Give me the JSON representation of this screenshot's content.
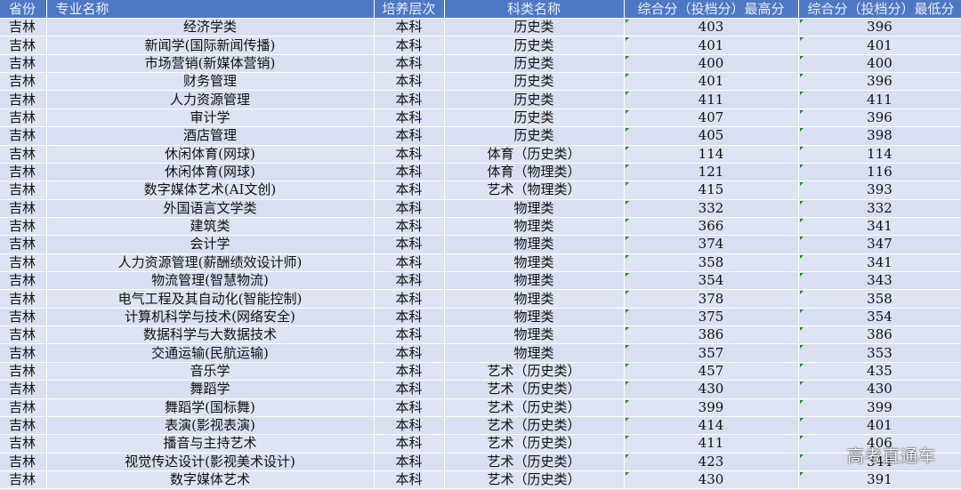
{
  "headers": [
    "省份",
    "专业名称",
    "培养层次",
    "科类名称",
    "综合分（投档分）最高分",
    "综合分（投档分）最低分"
  ],
  "rows": [
    [
      "吉林",
      "经济学类",
      "本科",
      "历史类",
      "403",
      "396"
    ],
    [
      "吉林",
      "新闻学(国际新闻传播)",
      "本科",
      "历史类",
      "401",
      "401"
    ],
    [
      "吉林",
      "市场营销(新媒体营销)",
      "本科",
      "历史类",
      "400",
      "400"
    ],
    [
      "吉林",
      "财务管理",
      "本科",
      "历史类",
      "401",
      "396"
    ],
    [
      "吉林",
      "人力资源管理",
      "本科",
      "历史类",
      "411",
      "411"
    ],
    [
      "吉林",
      "审计学",
      "本科",
      "历史类",
      "407",
      "396"
    ],
    [
      "吉林",
      "酒店管理",
      "本科",
      "历史类",
      "405",
      "398"
    ],
    [
      "吉林",
      "休闲体育(网球)",
      "本科",
      "体育（历史类）",
      "114",
      "114"
    ],
    [
      "吉林",
      "休闲体育(网球)",
      "本科",
      "体育（物理类）",
      "121",
      "116"
    ],
    [
      "吉林",
      "数字媒体艺术(AI文创)",
      "本科",
      "艺术（物理类）",
      "415",
      "393"
    ],
    [
      "吉林",
      "外国语言文学类",
      "本科",
      "物理类",
      "332",
      "332"
    ],
    [
      "吉林",
      "建筑类",
      "本科",
      "物理类",
      "366",
      "341"
    ],
    [
      "吉林",
      "会计学",
      "本科",
      "物理类",
      "374",
      "347"
    ],
    [
      "吉林",
      "人力资源管理(薪酬绩效设计师)",
      "本科",
      "物理类",
      "358",
      "341"
    ],
    [
      "吉林",
      "物流管理(智慧物流)",
      "本科",
      "物理类",
      "354",
      "343"
    ],
    [
      "吉林",
      "电气工程及其自动化(智能控制)",
      "本科",
      "物理类",
      "378",
      "358"
    ],
    [
      "吉林",
      "计算机科学与技术(网络安全)",
      "本科",
      "物理类",
      "375",
      "354"
    ],
    [
      "吉林",
      "数据科学与大数据技术",
      "本科",
      "物理类",
      "386",
      "386"
    ],
    [
      "吉林",
      "交通运输(民航运输)",
      "本科",
      "物理类",
      "357",
      "353"
    ],
    [
      "吉林",
      "音乐学",
      "本科",
      "艺术（历史类）",
      "457",
      "435"
    ],
    [
      "吉林",
      "舞蹈学",
      "本科",
      "艺术（历史类）",
      "430",
      "430"
    ],
    [
      "吉林",
      "舞蹈学(国标舞)",
      "本科",
      "艺术（历史类）",
      "399",
      "399"
    ],
    [
      "吉林",
      "表演(影视表演)",
      "本科",
      "艺术（历史类）",
      "414",
      "401"
    ],
    [
      "吉林",
      "播音与主持艺术",
      "本科",
      "艺术（历史类）",
      "411",
      "406"
    ],
    [
      "吉林",
      "视觉传达设计(影视美术设计)",
      "本科",
      "艺术（历史类）",
      "423",
      "344"
    ],
    [
      "吉林",
      "数字媒体艺术",
      "本科",
      "艺术（历史类）",
      "430",
      "391"
    ]
  ],
  "watermark": "高考直通车",
  "colors": {
    "header_bg": "#4e78c4",
    "row_bg": "#d7dff0",
    "grid": "#ffffff",
    "marker": "#1e8a2e"
  }
}
